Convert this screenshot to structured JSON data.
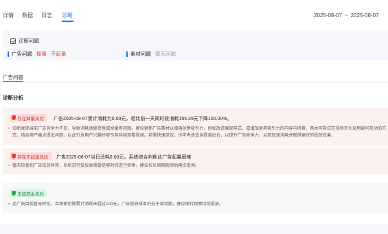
{
  "tabs": [
    {
      "label": "详情"
    },
    {
      "label": "数据"
    },
    {
      "label": "日志"
    },
    {
      "label": "诊断"
    }
  ],
  "date_range": {
    "start": "2025-08-07",
    "separator": "~",
    "end": "2025-08-07"
  },
  "problem_card": {
    "title": "诊断问题",
    "ad_problem_label": "广告问题",
    "ad_problem_tags": [
      "掉量",
      "不起量"
    ],
    "material_problem_label": "素材问题",
    "material_problem_value": "暂无问题"
  },
  "subtab": {
    "label": "广告问题"
  },
  "section_title": "诊断分析",
  "alerts": [
    {
      "badge": "存在掉量风险",
      "headline": "广告2025-08-07累计消耗为0.00元，相比前一天同时段消耗155.39元下降100.00%。",
      "bullet": "诊断发现当前广告竞争力不足，导致消耗速度变慢或掉量等问题。建议更新广告素材以增强创意吸引力，例如改进展现样式，或增加更具吸引力的内容与场景。具体可尝试在视频开头采用疑问互动的方式，结合用户痛点提出问题，以此引发用户兴趣并吸引其持续观看视频。若需快速见效，也可考虑适当提高出价，以提升广告竞争力，从而加速消耗并取得更好的投放效果。"
    },
    {
      "badge": "存在不起量风险",
      "headline": "广告2025-08-07当日消耗0.00元，系统综合判断此广告起量困难",
      "bullet": "暂未检查到广告投放异常，系统进行投放会需要足够时间进行探索，建议拉长周期观测后再次查询。"
    },
    {
      "badge": "未超成本风险",
      "headline": "",
      "bullet": "此广告目前暂无转化，且探索初期累计消耗未超过100元，广告投放成本仍处于波动期，建议保持观察持续投放。"
    }
  ]
}
